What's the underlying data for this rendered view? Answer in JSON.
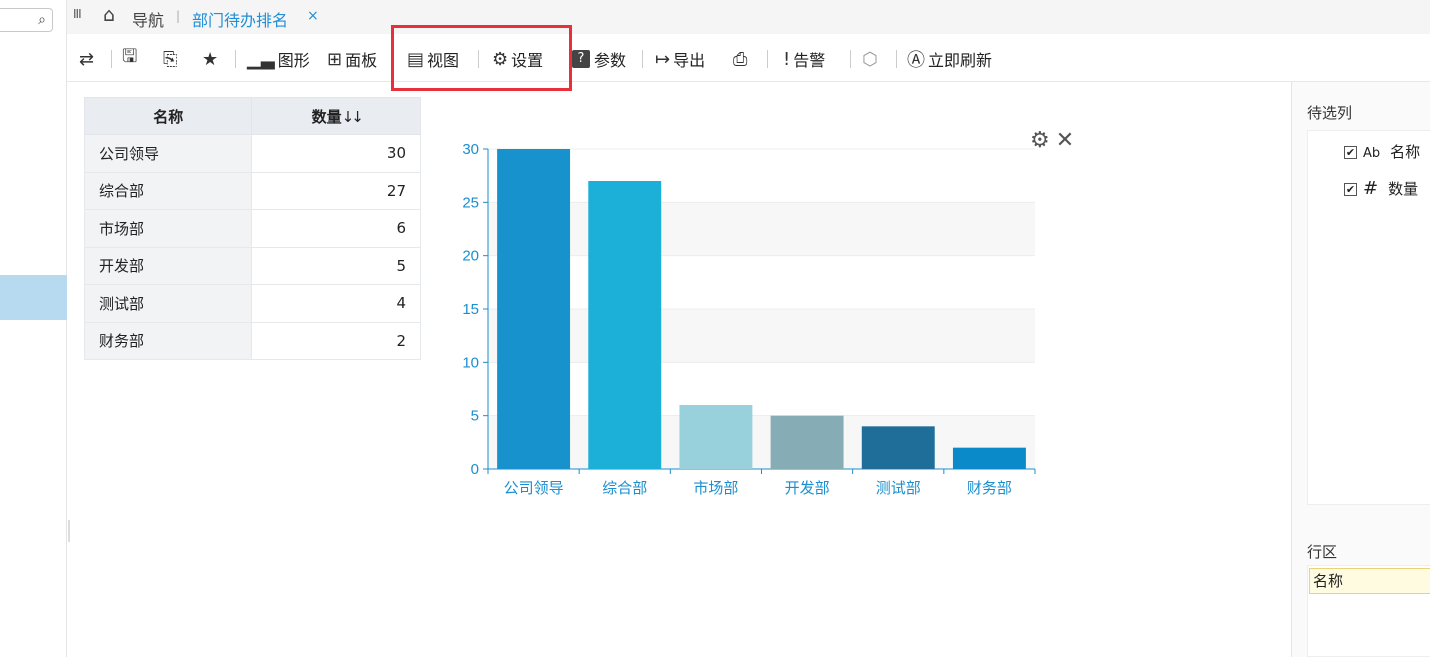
{
  "nav": {
    "search_icon": "search-icon",
    "menu_icon": "III",
    "home_icon": "home-icon",
    "home_label": "导航",
    "separator": "|",
    "active_tab": "部门待办排名",
    "close_symbol": "×"
  },
  "toolbar": {
    "chart_label": "图形",
    "panel_label": "面板",
    "view_label": "视图",
    "settings_label": "设置",
    "params_label": "参数",
    "export_label": "导出",
    "alert_label": "告警",
    "refresh_label": "立即刷新"
  },
  "table": {
    "headers": [
      "名称",
      "数量"
    ],
    "sort_icon": "↓↓",
    "rows": [
      {
        "name": "公司领导",
        "value": "30"
      },
      {
        "name": "综合部",
        "value": "27"
      },
      {
        "name": "市场部",
        "value": "6"
      },
      {
        "name": "开发部",
        "value": "5"
      },
      {
        "name": "测试部",
        "value": "4"
      },
      {
        "name": "财务部",
        "value": "2"
      }
    ]
  },
  "chart_data": {
    "type": "bar",
    "categories": [
      "公司领导",
      "综合部",
      "市场部",
      "开发部",
      "测试部",
      "财务部"
    ],
    "values": [
      30,
      27,
      6,
      5,
      4,
      2
    ],
    "colors": [
      "#1892cd",
      "#1cafd8",
      "#98d0dc",
      "#86adb6",
      "#1e6e99",
      "#0a8ac8"
    ],
    "ylim": [
      0,
      30
    ],
    "yticks": [
      0,
      5,
      10,
      15,
      20,
      25,
      30
    ],
    "axis_color": "#1a8fcf",
    "grid": true
  },
  "right_panel": {
    "pending_title": "待选列",
    "fields": [
      {
        "type": "Ab",
        "label": "名称",
        "checked": "✔"
      },
      {
        "type": "#",
        "label": "数量",
        "checked": "✔"
      }
    ],
    "row_title": "行区",
    "row_item": "名称"
  }
}
